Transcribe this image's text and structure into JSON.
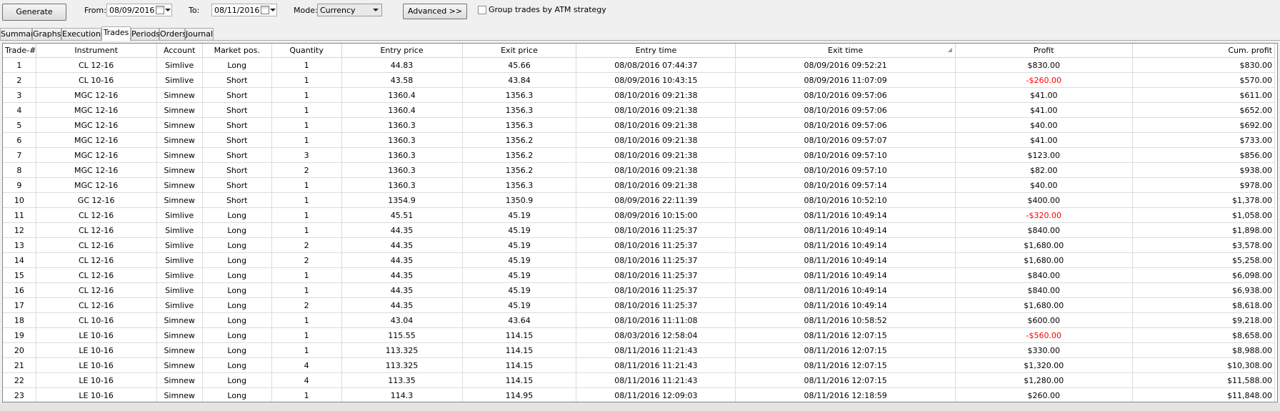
{
  "toolbar": {
    "generate_label": "Generate",
    "from_label": "From:",
    "from_value": "08/09/2016",
    "to_label": "To:",
    "to_value": "08/11/2016",
    "mode_label": "Mode:",
    "mode_value": "Currency",
    "advanced_label": "Advanced >>",
    "group_label": "Group trades by ATM strategy",
    "group_checked": false
  },
  "tabs": [
    {
      "label": "Summary",
      "active": false
    },
    {
      "label": "Graphs",
      "active": false
    },
    {
      "label": "Executions",
      "active": false
    },
    {
      "label": "Trades",
      "active": true
    },
    {
      "label": "Periods",
      "active": false
    },
    {
      "label": "Orders",
      "active": false
    },
    {
      "label": "Journal",
      "active": false
    }
  ],
  "columns": [
    "Trade-#",
    "Instrument",
    "Account",
    "Market pos.",
    "Quantity",
    "Entry price",
    "Exit price",
    "Entry time",
    "Exit time",
    "Profit",
    "Cum. profit"
  ],
  "colors": {
    "negative": "#ff0000"
  },
  "rows": [
    [
      "1",
      "CL 12-16",
      "Simlive",
      "Long",
      "1",
      "44.83",
      "45.66",
      "08/08/2016 07:44:37",
      "08/09/2016 09:52:21",
      "$830.00",
      "$830.00"
    ],
    [
      "2",
      "CL 10-16",
      "Simlive",
      "Short",
      "1",
      "43.58",
      "43.84",
      "08/09/2016 10:43:15",
      "08/09/2016 11:07:09",
      "-$260.00",
      "$570.00"
    ],
    [
      "3",
      "MGC 12-16",
      "Simnew",
      "Short",
      "1",
      "1360.4",
      "1356.3",
      "08/10/2016 09:21:38",
      "08/10/2016 09:57:06",
      "$41.00",
      "$611.00"
    ],
    [
      "4",
      "MGC 12-16",
      "Simnew",
      "Short",
      "1",
      "1360.4",
      "1356.3",
      "08/10/2016 09:21:38",
      "08/10/2016 09:57:06",
      "$41.00",
      "$652.00"
    ],
    [
      "5",
      "MGC 12-16",
      "Simnew",
      "Short",
      "1",
      "1360.3",
      "1356.3",
      "08/10/2016 09:21:38",
      "08/10/2016 09:57:06",
      "$40.00",
      "$692.00"
    ],
    [
      "6",
      "MGC 12-16",
      "Simnew",
      "Short",
      "1",
      "1360.3",
      "1356.2",
      "08/10/2016 09:21:38",
      "08/10/2016 09:57:07",
      "$41.00",
      "$733.00"
    ],
    [
      "7",
      "MGC 12-16",
      "Simnew",
      "Short",
      "3",
      "1360.3",
      "1356.2",
      "08/10/2016 09:21:38",
      "08/10/2016 09:57:10",
      "$123.00",
      "$856.00"
    ],
    [
      "8",
      "MGC 12-16",
      "Simnew",
      "Short",
      "2",
      "1360.3",
      "1356.2",
      "08/10/2016 09:21:38",
      "08/10/2016 09:57:10",
      "$82.00",
      "$938.00"
    ],
    [
      "9",
      "MGC 12-16",
      "Simnew",
      "Short",
      "1",
      "1360.3",
      "1356.3",
      "08/10/2016 09:21:38",
      "08/10/2016 09:57:14",
      "$40.00",
      "$978.00"
    ],
    [
      "10",
      "GC 12-16",
      "Simnew",
      "Short",
      "1",
      "1354.9",
      "1350.9",
      "08/09/2016 22:11:39",
      "08/10/2016 10:52:10",
      "$400.00",
      "$1,378.00"
    ],
    [
      "11",
      "CL 12-16",
      "Simlive",
      "Long",
      "1",
      "45.51",
      "45.19",
      "08/09/2016 10:15:00",
      "08/11/2016 10:49:14",
      "-$320.00",
      "$1,058.00"
    ],
    [
      "12",
      "CL 12-16",
      "Simlive",
      "Long",
      "1",
      "44.35",
      "45.19",
      "08/10/2016 11:25:37",
      "08/11/2016 10:49:14",
      "$840.00",
      "$1,898.00"
    ],
    [
      "13",
      "CL 12-16",
      "Simlive",
      "Long",
      "2",
      "44.35",
      "45.19",
      "08/10/2016 11:25:37",
      "08/11/2016 10:49:14",
      "$1,680.00",
      "$3,578.00"
    ],
    [
      "14",
      "CL 12-16",
      "Simlive",
      "Long",
      "2",
      "44.35",
      "45.19",
      "08/10/2016 11:25:37",
      "08/11/2016 10:49:14",
      "$1,680.00",
      "$5,258.00"
    ],
    [
      "15",
      "CL 12-16",
      "Simlive",
      "Long",
      "1",
      "44.35",
      "45.19",
      "08/10/2016 11:25:37",
      "08/11/2016 10:49:14",
      "$840.00",
      "$6,098.00"
    ],
    [
      "16",
      "CL 12-16",
      "Simlive",
      "Long",
      "1",
      "44.35",
      "45.19",
      "08/10/2016 11:25:37",
      "08/11/2016 10:49:14",
      "$840.00",
      "$6,938.00"
    ],
    [
      "17",
      "CL 12-16",
      "Simlive",
      "Long",
      "2",
      "44.35",
      "45.19",
      "08/10/2016 11:25:37",
      "08/11/2016 10:49:14",
      "$1,680.00",
      "$8,618.00"
    ],
    [
      "18",
      "CL 10-16",
      "Simnew",
      "Long",
      "1",
      "43.04",
      "43.64",
      "08/10/2016 11:11:08",
      "08/11/2016 10:58:52",
      "$600.00",
      "$9,218.00"
    ],
    [
      "19",
      "LE 10-16",
      "Simnew",
      "Long",
      "1",
      "115.55",
      "114.15",
      "08/03/2016 12:58:04",
      "08/11/2016 12:07:15",
      "-$560.00",
      "$8,658.00"
    ],
    [
      "20",
      "LE 10-16",
      "Simnew",
      "Long",
      "1",
      "113.325",
      "114.15",
      "08/11/2016 11:21:43",
      "08/11/2016 12:07:15",
      "$330.00",
      "$8,988.00"
    ],
    [
      "21",
      "LE 10-16",
      "Simnew",
      "Long",
      "4",
      "113.325",
      "114.15",
      "08/11/2016 11:21:43",
      "08/11/2016 12:07:15",
      "$1,320.00",
      "$10,308.00"
    ],
    [
      "22",
      "LE 10-16",
      "Simnew",
      "Long",
      "4",
      "113.35",
      "114.15",
      "08/11/2016 11:21:43",
      "08/11/2016 12:07:15",
      "$1,280.00",
      "$11,588.00"
    ],
    [
      "23",
      "LE 10-16",
      "Simnew",
      "Long",
      "1",
      "114.3",
      "114.95",
      "08/11/2016 12:09:03",
      "08/11/2016 12:18:59",
      "$260.00",
      "$11,848.00"
    ]
  ]
}
